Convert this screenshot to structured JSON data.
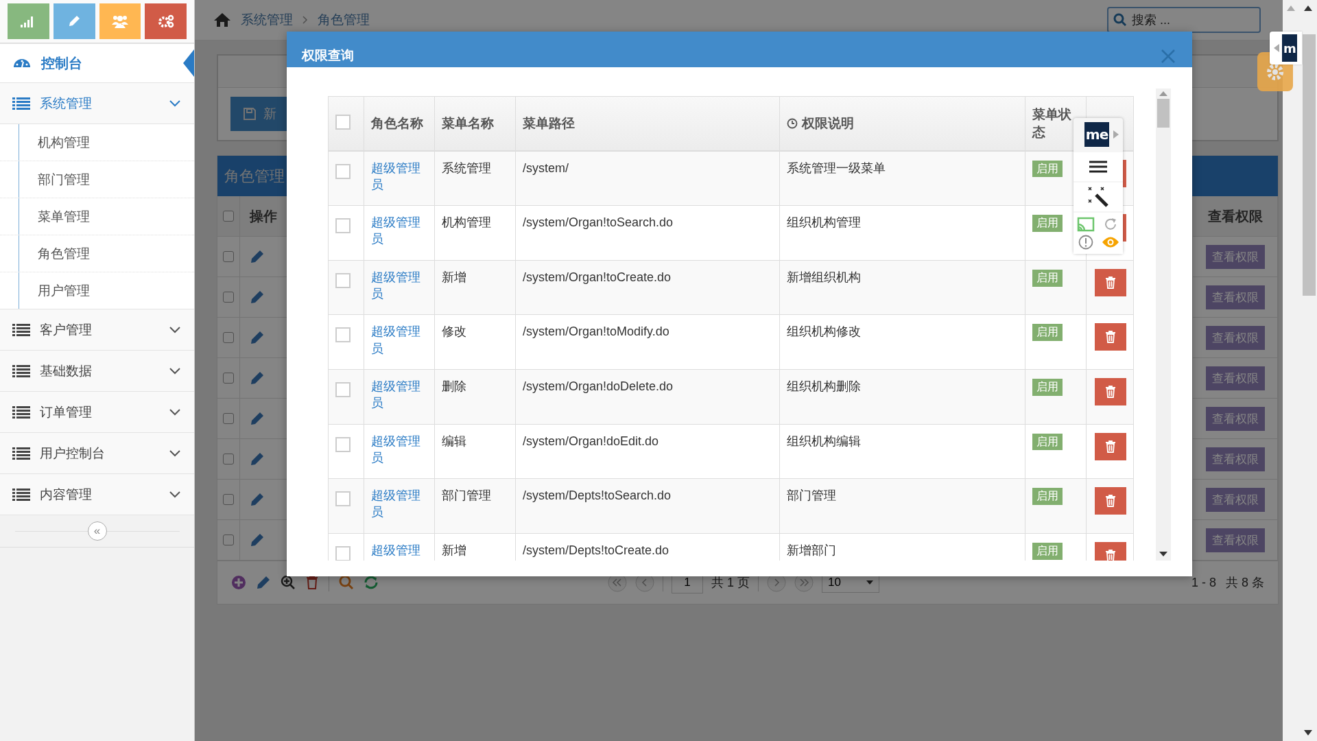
{
  "shortcuts": [
    {
      "kind": "chart",
      "color": "#87b87f"
    },
    {
      "kind": "pencil",
      "color": "#6fb3e0"
    },
    {
      "kind": "users",
      "color": "#ffb752"
    },
    {
      "kind": "gears",
      "color": "#d15b47"
    }
  ],
  "sidebar": {
    "dashboard": {
      "label": "控制台",
      "selected": true
    },
    "groups": [
      {
        "label": "系统管理",
        "expanded": true,
        "children": [
          {
            "label": "机构管理"
          },
          {
            "label": "部门管理"
          },
          {
            "label": "菜单管理"
          },
          {
            "label": "角色管理"
          },
          {
            "label": "用户管理"
          }
        ]
      },
      {
        "label": "客户管理",
        "expanded": false
      },
      {
        "label": "基础数据",
        "expanded": false
      },
      {
        "label": "订单管理",
        "expanded": false
      },
      {
        "label": "用户控制台",
        "expanded": false
      },
      {
        "label": "内容管理",
        "expanded": false
      }
    ],
    "collapse_button": "«"
  },
  "breadcrumb": [
    "系统管理",
    "角色管理"
  ],
  "search": {
    "placeholder": "搜索 ..."
  },
  "background_page": {
    "header_checked": false,
    "new_button": "新",
    "panel_title": "角色管理",
    "action_column": "操作",
    "view_column": "查看权限",
    "rows": [
      {
        "checked": false,
        "view_button": "查看权限"
      },
      {
        "checked": false,
        "view_button": "查看权限"
      },
      {
        "checked": false,
        "view_button": "查看权限"
      },
      {
        "checked": false,
        "view_button": "查看权限"
      },
      {
        "checked": false,
        "view_button": "查看权限"
      },
      {
        "checked": false,
        "view_button": "查看权限"
      },
      {
        "checked": false,
        "view_button": "查看权限"
      },
      {
        "checked": false,
        "view_button": "查看权限"
      }
    ],
    "pagination": {
      "page": "1",
      "total_pages": "共 1 页",
      "page_size": "10",
      "range": "1 - 8",
      "total": "共 8 条"
    }
  },
  "modal": {
    "title": "权限查询",
    "header_checked": false,
    "columns": [
      "角色名称",
      "菜单名称",
      "菜单路径",
      "权限说明",
      "菜单状态"
    ],
    "rows": [
      {
        "checked": false,
        "role": "超级管理员",
        "menu": "系统管理",
        "path": "/system/",
        "description": "系统管理一级菜单",
        "status": "启用"
      },
      {
        "checked": false,
        "role": "超级管理员",
        "menu": "机构管理",
        "path": "/system/Organ!toSearch.do",
        "description": "组织机构管理",
        "status": "启用"
      },
      {
        "checked": false,
        "role": "超级管理员",
        "menu": "新增",
        "path": "/system/Organ!toCreate.do",
        "description": "新增组织机构",
        "status": "启用"
      },
      {
        "checked": false,
        "role": "超级管理员",
        "menu": "修改",
        "path": "/system/Organ!toModify.do",
        "description": "组织机构修改",
        "status": "启用"
      },
      {
        "checked": false,
        "role": "超级管理员",
        "menu": "删除",
        "path": "/system/Organ!doDelete.do",
        "description": "组织机构删除",
        "status": "启用"
      },
      {
        "checked": false,
        "role": "超级管理员",
        "menu": "编辑",
        "path": "/system/Organ!doEdit.do",
        "description": "组织机构编辑",
        "status": "启用"
      },
      {
        "checked": false,
        "role": "超级管理员",
        "menu": "部门管理",
        "path": "/system/Depts!toSearch.do",
        "description": "部门管理",
        "status": "启用"
      },
      {
        "checked": false,
        "role": "超级管理",
        "menu": "新增",
        "path": "/system/Depts!toCreate.do",
        "description": "新增部门",
        "status": "启用"
      }
    ]
  },
  "extension_toolbar": {
    "logo": "me"
  },
  "extension_tab": {
    "logo": "m"
  }
}
